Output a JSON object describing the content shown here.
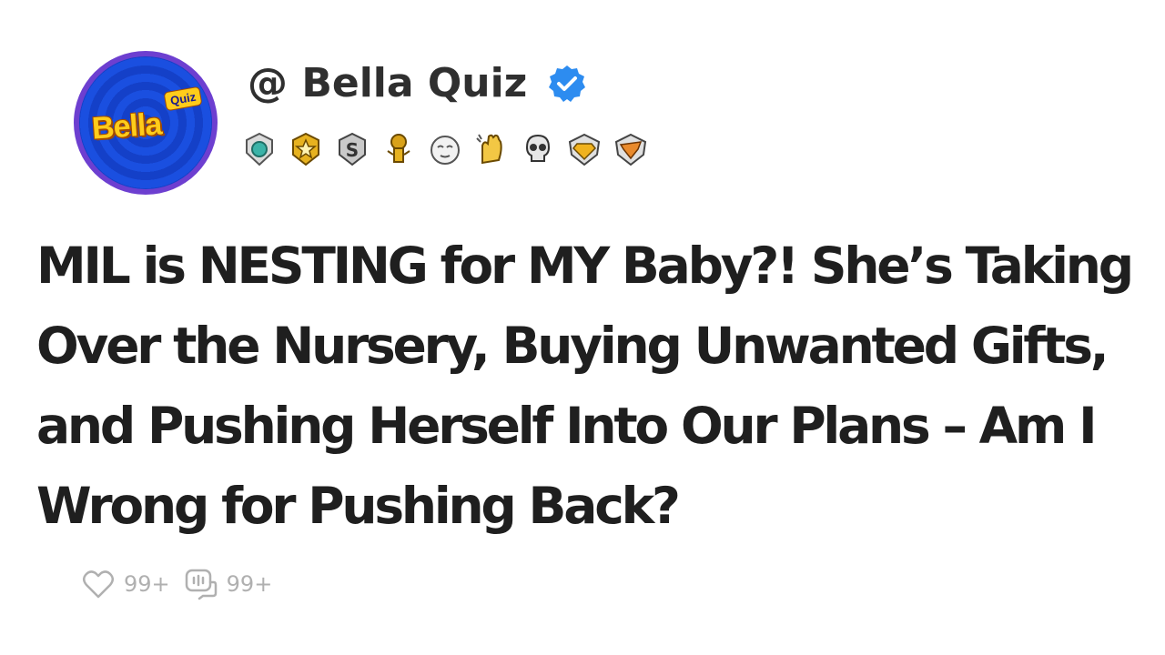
{
  "profile": {
    "avatar_logo_main": "Bella",
    "avatar_logo_tag": "Quiz",
    "handle": "@ Bella Quiz",
    "verified_icon": "verified-check-icon",
    "badges": [
      {
        "name": "teal-shield-badge-icon",
        "color": "#3bb3a8"
      },
      {
        "name": "gold-star-badge-icon",
        "color": "#e7b21f"
      },
      {
        "name": "silver-s-badge-icon",
        "color": "#9c9c9c"
      },
      {
        "name": "gold-trophy-badge-icon",
        "color": "#d9a21a"
      },
      {
        "name": "sleepy-face-badge-icon",
        "color": "#e0e0e0"
      },
      {
        "name": "clapping-hands-badge-icon",
        "color": "#f2c744"
      },
      {
        "name": "skull-badge-icon",
        "color": "#d7d7d7"
      },
      {
        "name": "gold-diamond-badge-icon",
        "color": "#f0b21e"
      },
      {
        "name": "orange-wing-badge-icon",
        "color": "#e98a2c"
      }
    ]
  },
  "post": {
    "title": "MIL is NESTING for MY Baby?! She’s Taking Over the Nursery, Buying Unwanted Gifts, and Pushing Herself Into Our Plans – Am I Wrong for Pushing Back?"
  },
  "actions": {
    "like_count": "99+",
    "like_icon": "heart-icon",
    "comment_count": "99+",
    "comment_icon": "comment-icon"
  },
  "colors": {
    "avatar_ring": "#6d3fd0",
    "avatar_bg": "#1a4fe0",
    "verified_blue": "#2d8cf0",
    "title_text": "#1f1f1f",
    "muted": "#b0b0b0"
  }
}
